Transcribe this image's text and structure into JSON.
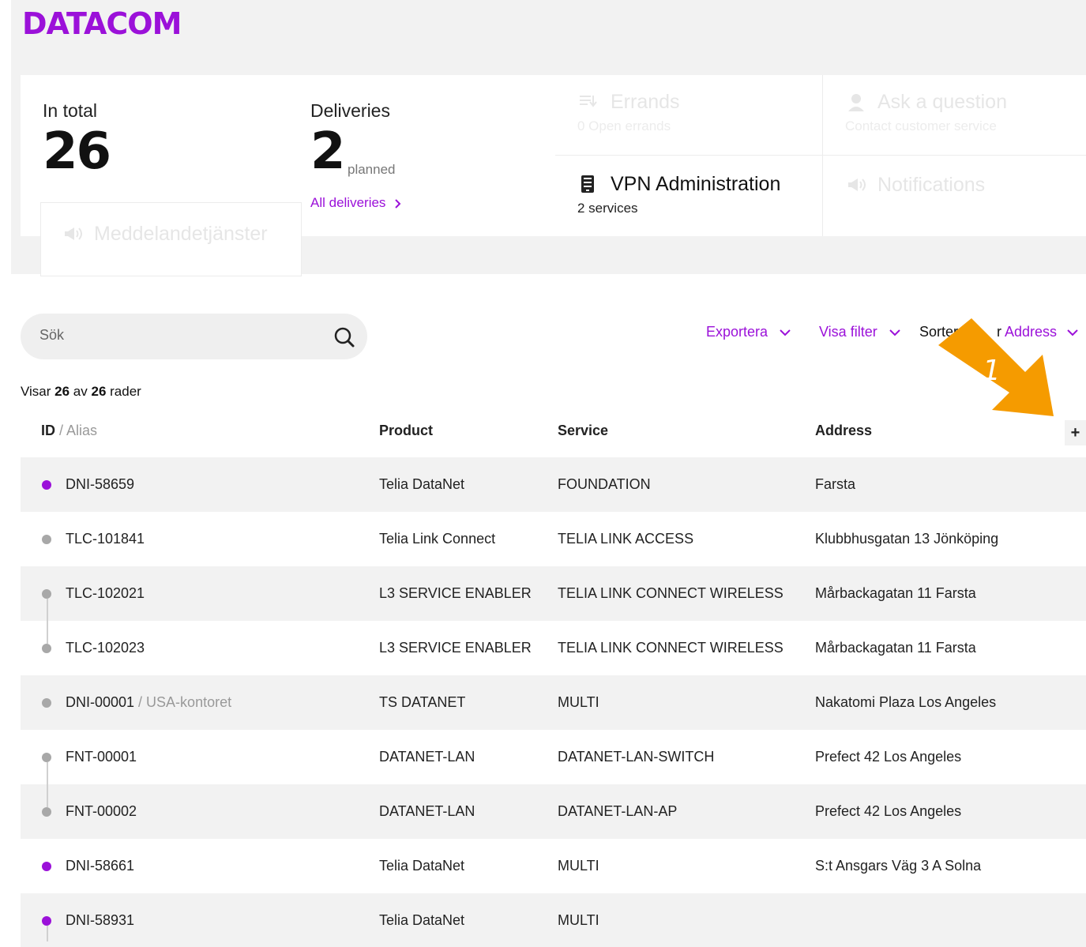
{
  "brand": {
    "logo": "DATACOM",
    "accent": "#9b11d9"
  },
  "summary": {
    "total_label": "In total",
    "total_value": "26",
    "deliveries_label": "Deliveries",
    "deliveries_value": "2",
    "deliveries_suffix": "planned",
    "deliveries_link": "All deliveries"
  },
  "tiles": {
    "errands": {
      "title": "Errands",
      "sub": "0 Open errands",
      "icon": "errands-icon"
    },
    "ask": {
      "title": "Ask a question",
      "sub": "Contact customer service",
      "icon": "person-icon"
    },
    "vpn": {
      "title": "VPN Administration",
      "sub": "2 services",
      "icon": "device-icon"
    },
    "notifications": {
      "title": "Notifications",
      "icon": "megaphone-icon"
    },
    "messaging": {
      "title": "Meddelandetjänster",
      "icon": "megaphone-icon"
    }
  },
  "search": {
    "placeholder": "Sök"
  },
  "toolbar": {
    "export": "Exportera",
    "filter": "Visa filter",
    "sort_prefix": "Sorter",
    "sort_suffix": "r",
    "sort_value": "Address"
  },
  "annotation": {
    "label": "1",
    "color": "#f59b00"
  },
  "count": {
    "prefix": "Visar ",
    "shown": "26",
    "middle": " av ",
    "total": "26",
    "suffix": " rader"
  },
  "table": {
    "headers": {
      "id": "ID",
      "alias": " / Alias",
      "product": "Product",
      "service": "Service",
      "address": "Address",
      "add": "+"
    },
    "rows": [
      {
        "status": "purple",
        "id": "DNI-58659",
        "alias": "",
        "product": "Telia DataNet",
        "service": "FOUNDATION",
        "address": "Farsta"
      },
      {
        "status": "gray",
        "id": "TLC-101841",
        "alias": "",
        "product": "Telia Link Connect",
        "service": "TELIA LINK ACCESS",
        "address": "Klubbhusgatan 13 Jönköping"
      },
      {
        "status": "gray",
        "id": "TLC-102021",
        "alias": "",
        "product": "L3 SERVICE ENABLER",
        "service": "TELIA LINK CONNECT WIRELESS",
        "address": "Mårbackagatan 11 Farsta"
      },
      {
        "status": "gray",
        "id": "TLC-102023",
        "alias": "",
        "product": "L3 SERVICE ENABLER",
        "service": "TELIA LINK CONNECT WIRELESS",
        "address": "Mårbackagatan 11 Farsta"
      },
      {
        "status": "gray",
        "id": "DNI-00001",
        "alias": " / USA-kontoret",
        "product": "TS DATANET",
        "service": "MULTI",
        "address": "Nakatomi Plaza Los Angeles"
      },
      {
        "status": "gray",
        "id": "FNT-00001",
        "alias": "",
        "product": "DATANET-LAN",
        "service": "DATANET-LAN-SWITCH",
        "address": "Prefect 42 Los Angeles"
      },
      {
        "status": "gray",
        "id": "FNT-00002",
        "alias": "",
        "product": "DATANET-LAN",
        "service": "DATANET-LAN-AP",
        "address": "Prefect 42 Los Angeles"
      },
      {
        "status": "purple",
        "id": "DNI-58661",
        "alias": "",
        "product": "Telia DataNet",
        "service": "MULTI",
        "address": "S:t Ansgars Väg 3 A Solna"
      },
      {
        "status": "purple",
        "id": "DNI-58931",
        "alias": "",
        "product": "Telia DataNet",
        "service": "MULTI",
        "address": ""
      }
    ]
  }
}
